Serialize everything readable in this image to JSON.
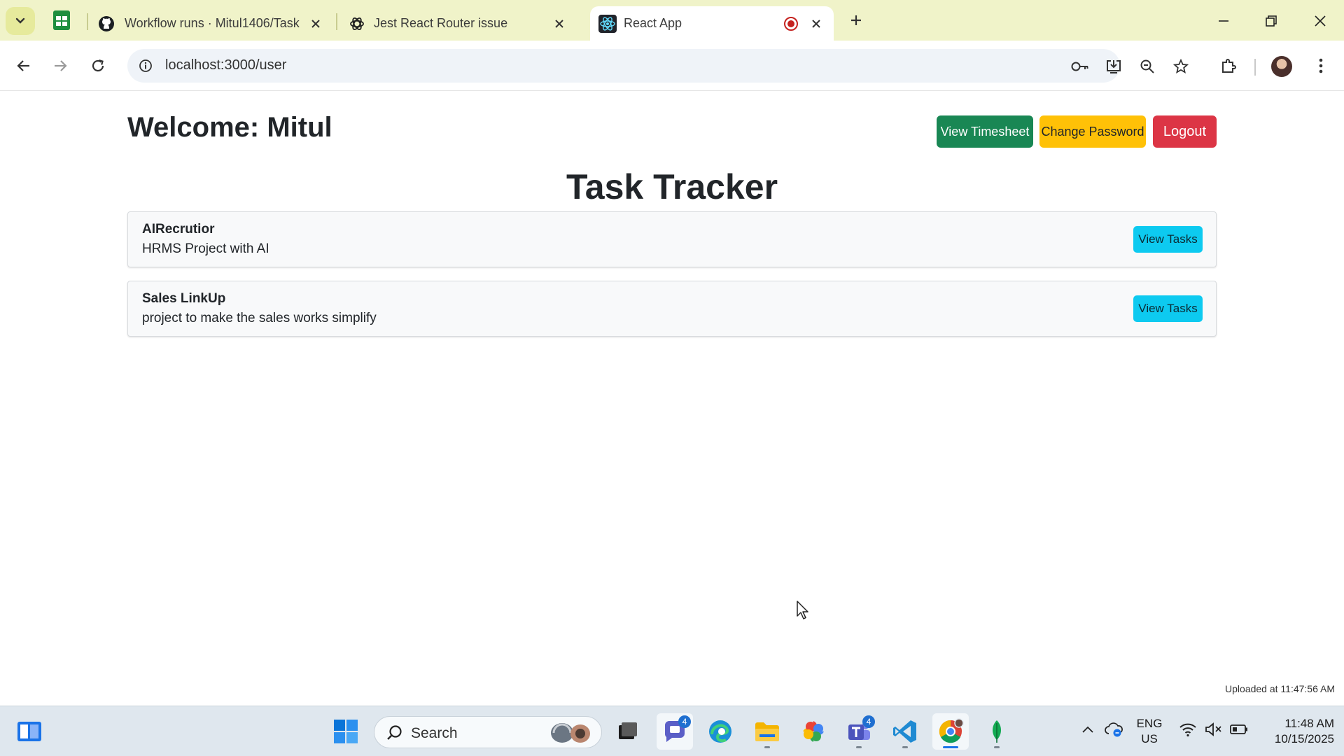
{
  "browser": {
    "tabs": [
      {
        "title": "Workflow runs · Mitul1406/Task",
        "icon": "github-icon"
      },
      {
        "title": "Jest React Router issue",
        "icon": "chatgpt-icon"
      },
      {
        "title": "React App",
        "icon": "react-icon",
        "active": true,
        "recording": true
      }
    ],
    "url": "localhost:3000/user"
  },
  "page": {
    "welcome": "Welcome: Mitul",
    "buttons": {
      "view_timesheet": "View Timesheet",
      "change_password": "Change Password",
      "logout": "Logout"
    },
    "title": "Task Tracker",
    "projects": [
      {
        "name": "AIRecrutior",
        "description": "HRMS Project with AI",
        "button": "View Tasks"
      },
      {
        "name": "Sales LinkUp",
        "description": "project to make the sales works simplify",
        "button": "View Tasks"
      }
    ],
    "upload_note": "Uploaded at 11:47:56 AM"
  },
  "taskbar": {
    "search_label": "Search",
    "badges": {
      "chat": "4",
      "teams": "4"
    },
    "language": {
      "line1": "ENG",
      "line2": "US"
    },
    "time": "11:48 AM",
    "date": "10/15/2025"
  },
  "colors": {
    "success": "#198754",
    "warning": "#ffc107",
    "danger": "#dc3545",
    "info": "#0dcaf0",
    "tabbar": "#f0f3c9"
  }
}
